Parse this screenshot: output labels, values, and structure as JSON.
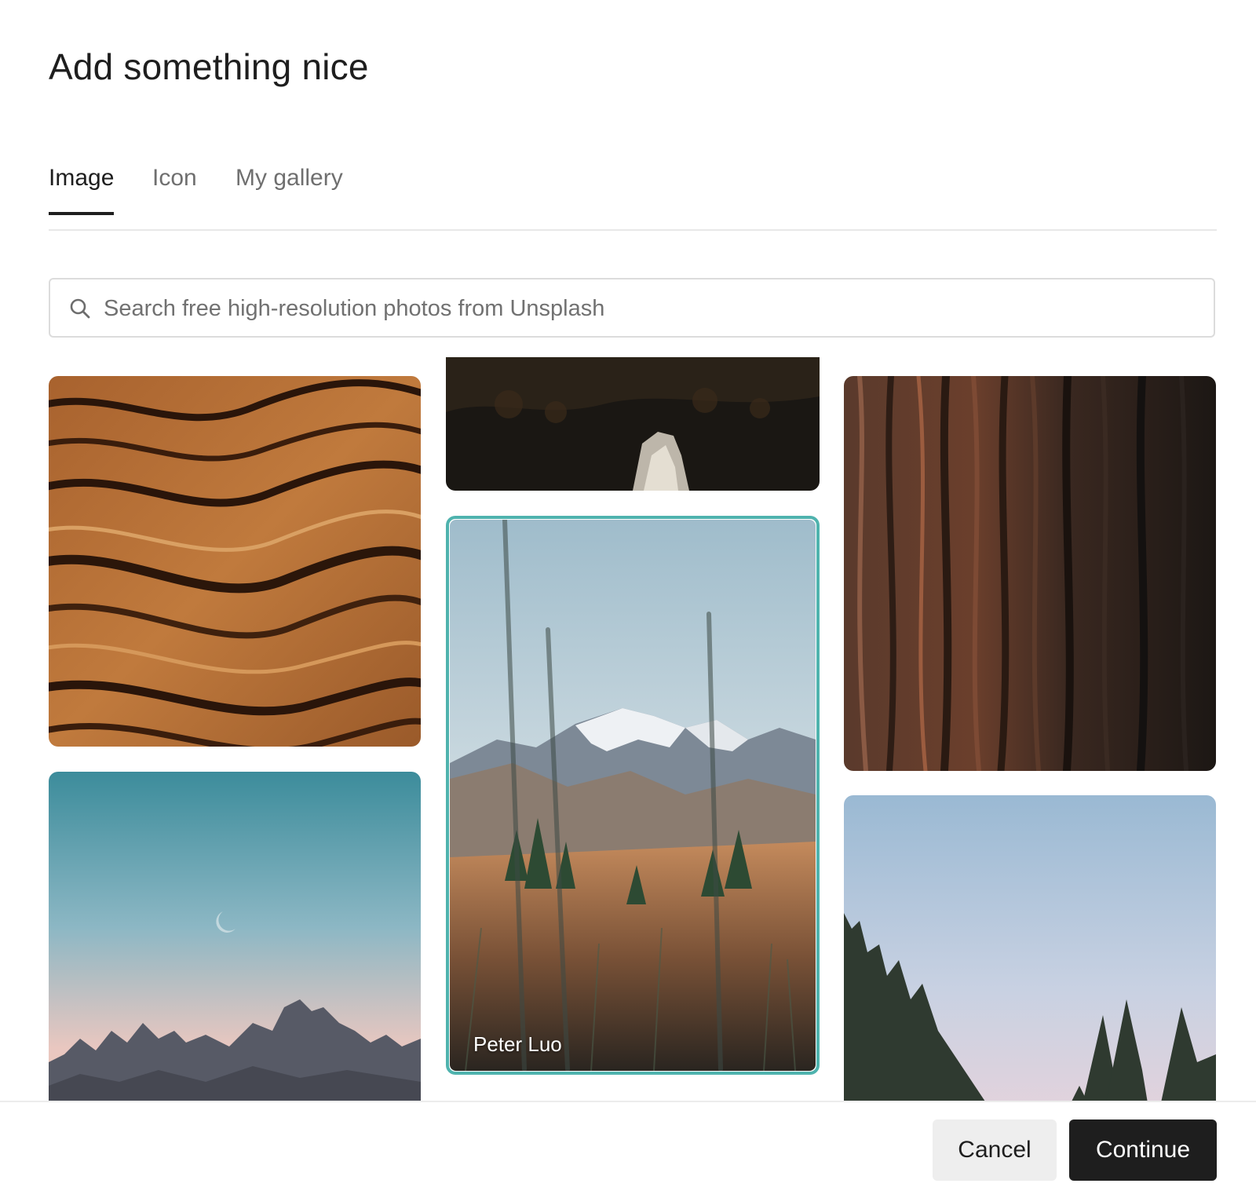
{
  "dialog": {
    "title": "Add something nice"
  },
  "tabs": [
    {
      "label": "Image",
      "active": true
    },
    {
      "label": "Icon",
      "active": false
    },
    {
      "label": "My gallery",
      "active": false
    }
  ],
  "search": {
    "placeholder": "Search free high-resolution photos from Unsplash",
    "icon": "search-icon"
  },
  "photos": [
    {
      "name": "photo-orange-waves"
    },
    {
      "name": "photo-dark-forest"
    },
    {
      "name": "photo-tree-bark"
    },
    {
      "name": "photo-mountain-peaks"
    },
    {
      "name": "photo-mountain-grass",
      "credit": "Peter Luo",
      "selected": true
    },
    {
      "name": "photo-pine-trees"
    }
  ],
  "accent_color": "#4fb3ae",
  "footer": {
    "cancel_label": "Cancel",
    "continue_label": "Continue"
  }
}
